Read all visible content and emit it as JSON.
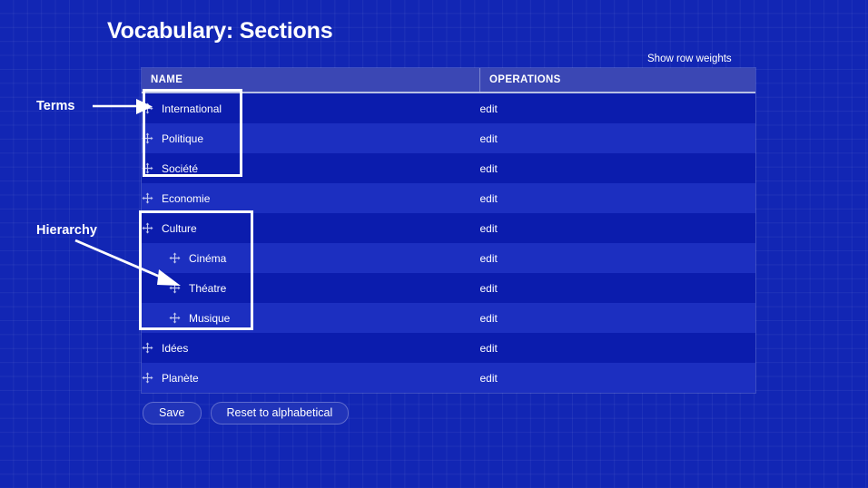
{
  "page": {
    "title": "Vocabulary: Sections",
    "background_color": "#1226b4"
  },
  "toolbar": {
    "show_row_weights_label": "Show row weights"
  },
  "table": {
    "columns": [
      {
        "key": "name",
        "label": "NAME"
      },
      {
        "key": "operations",
        "label": "OPERATIONS"
      }
    ],
    "rows": [
      {
        "name": "International",
        "depth": 0,
        "operation": "edit"
      },
      {
        "name": "Politique",
        "depth": 0,
        "operation": "edit"
      },
      {
        "name": "Société",
        "depth": 0,
        "operation": "edit"
      },
      {
        "name": "Economie",
        "depth": 0,
        "operation": "edit"
      },
      {
        "name": "Culture",
        "depth": 0,
        "operation": "edit"
      },
      {
        "name": "Cinéma",
        "depth": 1,
        "operation": "edit"
      },
      {
        "name": "Théatre",
        "depth": 1,
        "operation": "edit"
      },
      {
        "name": "Musique",
        "depth": 1,
        "operation": "edit"
      },
      {
        "name": "Idées",
        "depth": 0,
        "operation": "edit"
      },
      {
        "name": "Planète",
        "depth": 0,
        "operation": "edit"
      }
    ],
    "drag_handle_icon": "move-icon",
    "header_bg": "#3b47b4",
    "row_odd_bg": "#0b1cad",
    "row_even_bg": "#1c2fc0"
  },
  "buttons": {
    "save_label": "Save",
    "reset_label": "Reset to alphabetical"
  },
  "annotations": [
    {
      "id": "terms",
      "label": "Terms"
    },
    {
      "id": "hierarchy",
      "label": "Hierarchy"
    }
  ],
  "annotation_labels": {
    "terms": "Terms",
    "hierarchy": "Hierarchy"
  }
}
